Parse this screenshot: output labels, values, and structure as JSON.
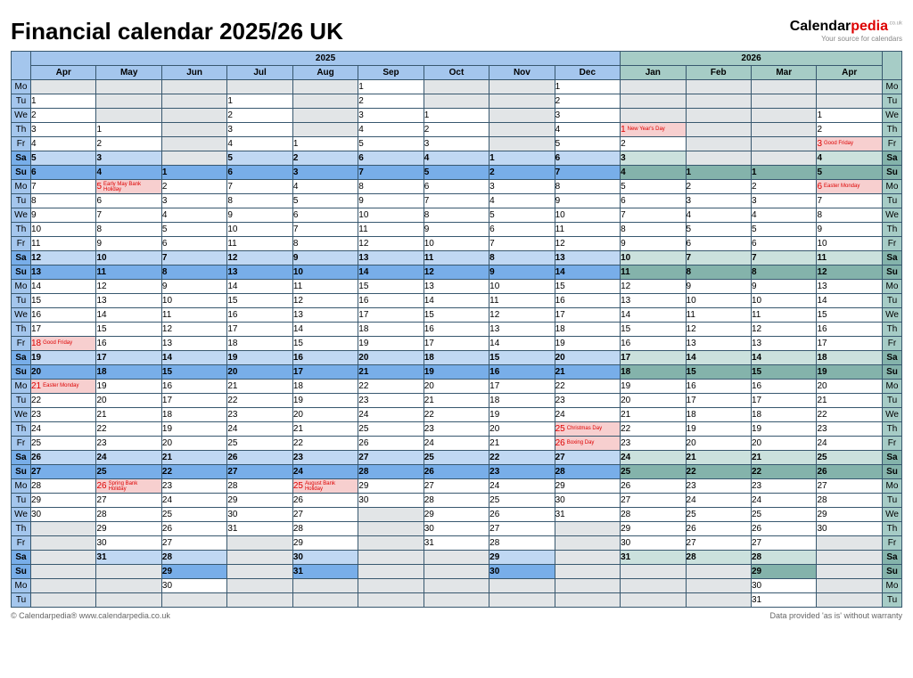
{
  "title": "Financial calendar 2025/26 UK",
  "brand_b": "Calendar",
  "brand_r": "pedia",
  "brand_dom": ".co.uk",
  "brand_tag": "Your source for calendars",
  "footer_left": "©  Calendarpedia®    www.calendarpedia.co.uk",
  "footer_right": "Data provided 'as is' without warranty",
  "years": [
    "2025",
    "2026"
  ],
  "months25": [
    "Apr",
    "May",
    "Jun",
    "Jul",
    "Aug",
    "Sep",
    "Oct",
    "Nov",
    "Dec"
  ],
  "months26": [
    "Jan",
    "Feb",
    "Mar",
    "Apr"
  ],
  "dow": [
    "Mo",
    "Tu",
    "We",
    "Th",
    "Fr",
    "Sa",
    "Su",
    "Mo",
    "Tu",
    "We",
    "Th",
    "Fr",
    "Sa",
    "Su",
    "Mo",
    "Tu",
    "We",
    "Th",
    "Fr",
    "Sa",
    "Su",
    "Mo",
    "Tu",
    "We",
    "Th",
    "Fr",
    "Sa",
    "Su",
    "Mo",
    "Tu",
    "We",
    "Th",
    "Fr",
    "Sa",
    "Su",
    "Mo",
    "Tu"
  ],
  "start_dow": {
    "Apr25": 1,
    "May25": 3,
    "Jun25": 6,
    "Jul25": 1,
    "Aug25": 4,
    "Sep25": 0,
    "Oct25": 2,
    "Nov25": 5,
    "Dec25": 0,
    "Jan26": 3,
    "Feb26": 6,
    "Mar26": 6,
    "Apr26": 2
  },
  "month_len": {
    "Apr25": 30,
    "May25": 31,
    "Jun25": 30,
    "Jul25": 31,
    "Aug25": 31,
    "Sep25": 30,
    "Oct25": 31,
    "Nov25": 30,
    "Dec25": 31,
    "Jan26": 31,
    "Feb26": 28,
    "Mar26": 31,
    "Apr26": 30
  },
  "holidays": {
    "Apr25-18": "Good Friday",
    "Apr25-21": "Easter Monday",
    "May25-5": "Early May Bank Holiday",
    "May25-26": "Spring Bank  Holiday",
    "Aug25-25": "August Bank  Holiday",
    "Dec25-25": "Christmas Day",
    "Dec25-26": "Boxing Day",
    "Jan26-1": "New Year's Day",
    "Apr26-3": "Good Friday",
    "Apr26-6": "Easter Monday"
  }
}
